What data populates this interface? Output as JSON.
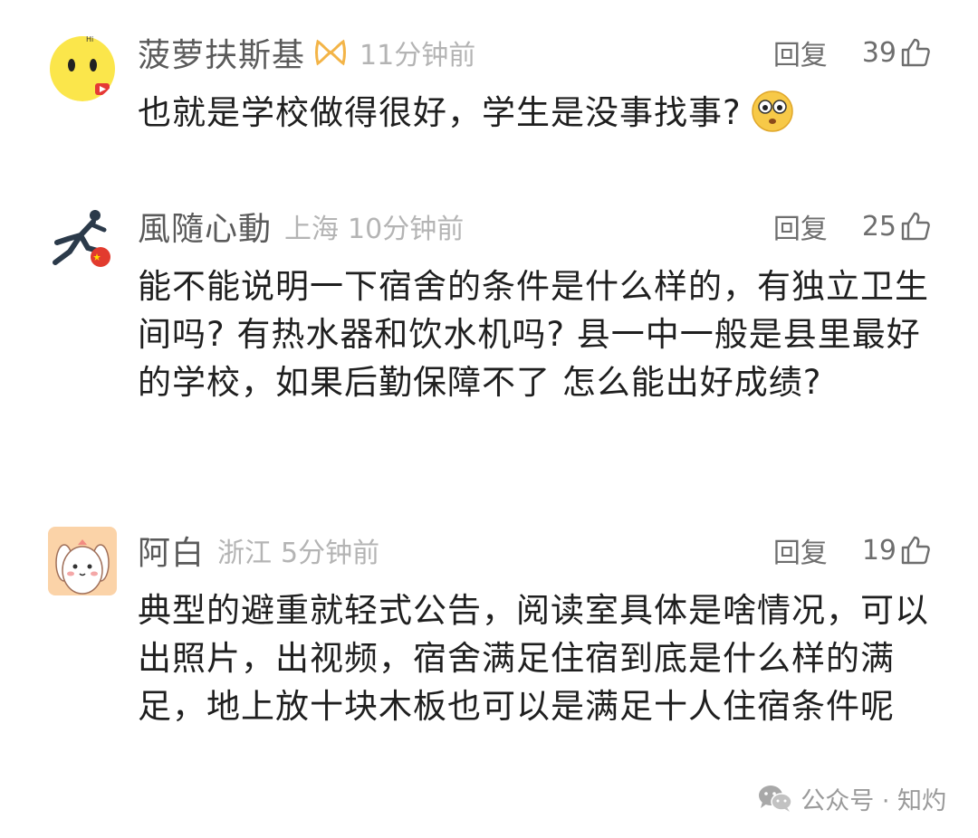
{
  "comments": [
    {
      "username": "菠萝扶斯基",
      "location": "",
      "time": "11分钟前",
      "reply_label": "回复",
      "likes": "39",
      "content": "也就是学校做得很好，学生是没事找事?",
      "badge_icon": "ribbon-badge-icon",
      "emoji": "surprised-face-emoji"
    },
    {
      "username": "風隨心動",
      "location": "上海",
      "time": "10分钟前",
      "reply_label": "回复",
      "likes": "25",
      "content": "能不能说明一下宿舍的条件是什么样的，有独立卫生间吗? 有热水器和饮水机吗? 县一中一般是县里最好的学校，如果后勤保障不了 怎么能出好成绩?"
    },
    {
      "username": "阿白",
      "location": "浙江",
      "time": "5分钟前",
      "reply_label": "回复",
      "likes": "19",
      "content": "典型的避重就轻式公告，阅读室具体是啥情况，可以出照片，出视频，宿舍满足住宿到底是什么样的满足，地上放十块木板也可以是满足十人住宿条件呢"
    }
  ],
  "watermark": {
    "text": "公众号 · 知灼",
    "icon": "wechat-icon"
  },
  "colors": {
    "username": "#5a5a5a",
    "meta": "#b4b4b4",
    "content": "#1f1f1f",
    "action": "#6e6e6e"
  }
}
